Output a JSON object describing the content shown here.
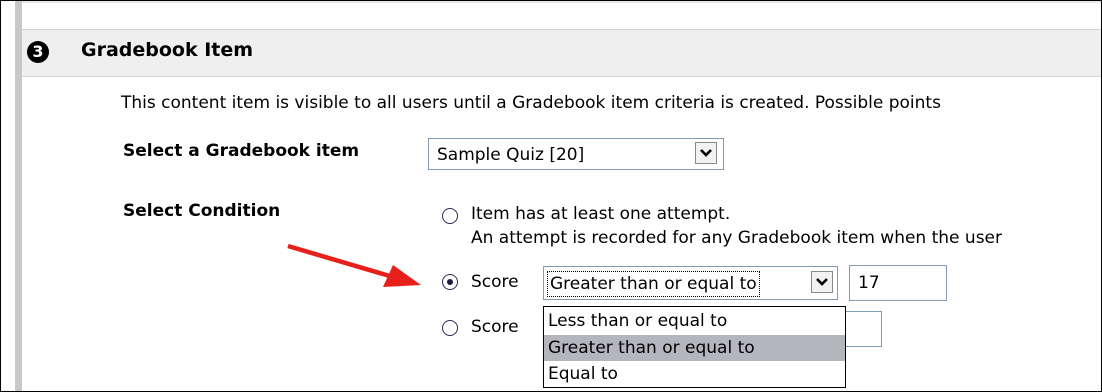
{
  "section": {
    "step_number": "3",
    "title": "Gradebook Item",
    "description": "This content item is visible to all users until a Gradebook item criteria is created. Possible points"
  },
  "gradebook_item": {
    "label": "Select a Gradebook item",
    "selected": "Sample Quiz [20]"
  },
  "condition": {
    "label": "Select Condition",
    "option_attempt": {
      "text": "Item has at least one attempt.",
      "note": "An attempt is recorded for any Gradebook item when the user"
    },
    "option_score1": {
      "label": "Score",
      "operator": "Greater than or equal to",
      "value": "17",
      "checked": true
    },
    "option_score2": {
      "label": "Score",
      "checked": false
    },
    "operator_options": [
      "Less than or equal to",
      "Greater than or equal to",
      "Equal to"
    ],
    "highlighted_option": "Greater than or equal to"
  },
  "colors": {
    "annotation_arrow": "#e8201c",
    "header_band": "#efefef",
    "selected_option": "#b5b5bd"
  },
  "icons": {
    "step": "circled-number-icon",
    "dropdown": "chevron-down-icon",
    "annotation": "red-arrow-icon"
  }
}
